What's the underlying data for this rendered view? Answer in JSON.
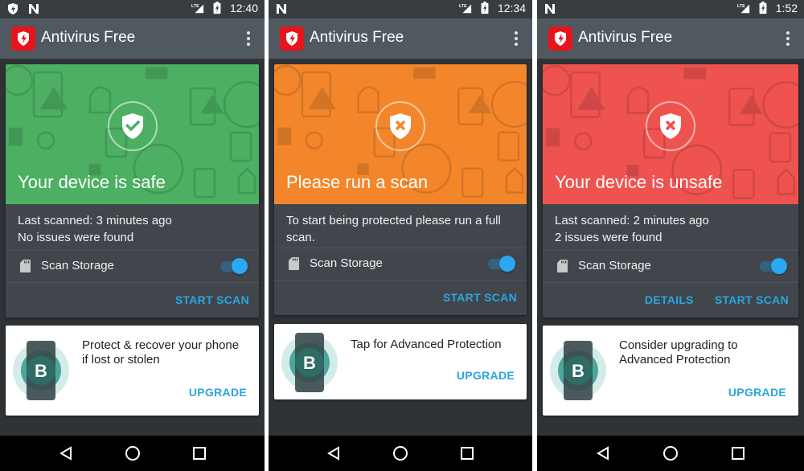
{
  "colors": {
    "safe": "#4caf62",
    "warning": "#f3862b",
    "unsafe": "#ef5350",
    "accent": "#29a6e0",
    "brand_red": "#e8141b"
  },
  "screens": [
    {
      "statusbar": {
        "left_icons": [
          "bitdefender-shield-icon",
          "n-notification-icon"
        ],
        "network": "LTE",
        "time": "12:40"
      },
      "appbar": {
        "title": "Antivirus Free",
        "logo": "bitdefender-logo-icon",
        "menu": "overflow-menu-icon"
      },
      "status": {
        "state": "safe",
        "badge_icon": "shield-check-icon",
        "title": "Your device is safe",
        "description_lines": [
          "Last scanned: 3 minutes ago",
          "No issues were found"
        ]
      },
      "storage": {
        "label": "Scan Storage",
        "toggle_on": true
      },
      "actions": [
        {
          "label": "START SCAN"
        }
      ],
      "promo": {
        "text": "Protect & recover your phone if lost or stolen",
        "button": "UPGRADE"
      }
    },
    {
      "statusbar": {
        "left_icons": [
          "n-notification-icon"
        ],
        "network": "LTE",
        "time": "12:34"
      },
      "appbar": {
        "title": "Antivirus Free",
        "logo": "bitdefender-logo-icon",
        "menu": "overflow-menu-icon"
      },
      "status": {
        "state": "warning",
        "badge_icon": "shield-x-icon",
        "title": "Please run a scan",
        "description_lines": [
          "To start being protected please run a full scan."
        ]
      },
      "storage": {
        "label": "Scan Storage",
        "toggle_on": true
      },
      "actions": [
        {
          "label": "START SCAN"
        }
      ],
      "promo": {
        "text": "Tap for Advanced Protection",
        "button": "UPGRADE"
      }
    },
    {
      "statusbar": {
        "left_icons": [
          "n-notification-icon"
        ],
        "network": "LTE",
        "time": "1:52"
      },
      "appbar": {
        "title": "Antivirus Free",
        "logo": "bitdefender-logo-icon",
        "menu": "overflow-menu-icon"
      },
      "status": {
        "state": "unsafe",
        "badge_icon": "shield-x-icon",
        "title": "Your device is unsafe",
        "description_lines": [
          "Last scanned: 2 minutes ago",
          "2 issues were found"
        ]
      },
      "storage": {
        "label": "Scan Storage",
        "toggle_on": true
      },
      "actions": [
        {
          "label": "DETAILS"
        },
        {
          "label": "START SCAN"
        }
      ],
      "promo": {
        "text": "Consider upgrading to Advanced Protection",
        "button": "UPGRADE"
      }
    }
  ]
}
